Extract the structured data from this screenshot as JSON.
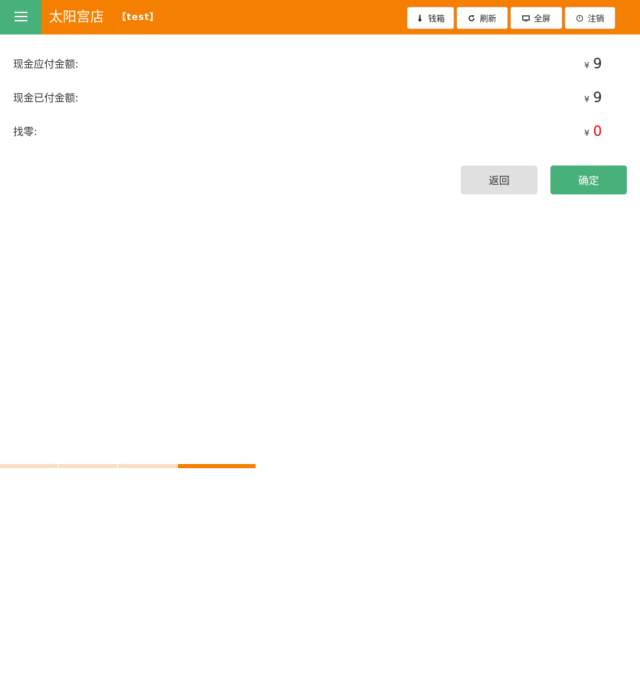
{
  "header": {
    "store_name": "太阳宫店",
    "store_tag": "【test】",
    "brand_color": "#f57f00",
    "menu_color": "#48b07a",
    "buttons": [
      {
        "label": "钱箱",
        "icon": "cashbox-icon"
      },
      {
        "label": "刷新",
        "icon": "refresh-icon"
      },
      {
        "label": "全屏",
        "icon": "monitor-icon"
      },
      {
        "label": "注销",
        "icon": "power-icon"
      }
    ]
  },
  "payment": {
    "currency_symbol": "¥",
    "rows": [
      {
        "label": "现金应付金额:",
        "amount": "9"
      },
      {
        "label": "现金已付金额:",
        "amount": "9"
      },
      {
        "label": "找零:",
        "amount": "0",
        "amount_color": "#e60000"
      }
    ]
  },
  "actions": {
    "back_label": "返回",
    "confirm_label": "确定"
  },
  "progress": {
    "steps_total": 4,
    "active_step": 4
  }
}
